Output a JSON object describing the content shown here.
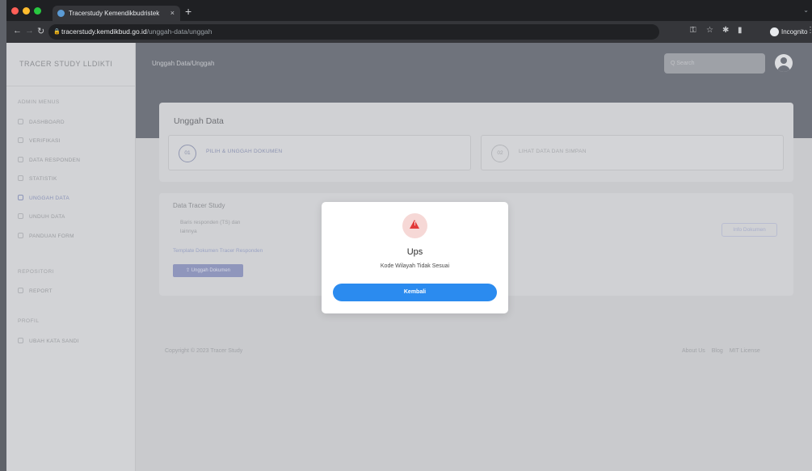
{
  "browser": {
    "tab_title": "Tracerstudy Kemendikbudristek",
    "tab_close": "×",
    "new_tab": "+",
    "url_host": "tracerstudy.kemdikbud.go.id",
    "url_path": "/unggah-data/unggah",
    "incognito_label": "Incognito",
    "traffic_colors": [
      "#ff5f57",
      "#febc2e",
      "#28c840"
    ]
  },
  "sidebar": {
    "brand": "TRACER STUDY LLDIKTI",
    "sections": [
      {
        "heading": "ADMIN MENUS",
        "items": [
          {
            "label": "DASHBOARD",
            "icon": "dashboard-icon"
          },
          {
            "label": "VERIFIKASI",
            "icon": "verify-icon"
          },
          {
            "label": "DATA RESPONDEN",
            "icon": "responden-icon"
          },
          {
            "label": "STATISTIK",
            "icon": "chart-icon"
          },
          {
            "label": "UNGGAH DATA",
            "icon": "upload-icon",
            "active": true
          },
          {
            "label": "UNDUH DATA",
            "icon": "download-icon"
          },
          {
            "label": "PANDUAN FORM",
            "icon": "guide-icon"
          }
        ]
      },
      {
        "heading": "REPOSITORI",
        "items": [
          {
            "label": "REPORT",
            "icon": "report-icon"
          }
        ]
      },
      {
        "heading": "PROFIL",
        "items": [
          {
            "label": "UBAH KATA SANDI",
            "icon": "key-icon"
          }
        ]
      }
    ]
  },
  "header": {
    "breadcrumb": "Unggah Data/Unggah",
    "search_placeholder": "Q Search"
  },
  "upload_card": {
    "title": "Unggah Data",
    "steps": [
      {
        "num": "01",
        "label": "PILIH & UNGGAH DOKUMEN",
        "active": true
      },
      {
        "num": "02",
        "label": "LIHAT DATA DAN SIMPAN",
        "active": false
      }
    ]
  },
  "tracer_card": {
    "title": "Data Tracer Study",
    "line1": "Baris responden (TS) dan",
    "line2": "lainnya",
    "template_link": "Template Dokumen Tracer Responden",
    "upload_button": "Unggah Dokumen",
    "info_button": "Info Dokumen"
  },
  "footer": {
    "copyright": "Copyright © 2023 Tracer Study",
    "links": [
      "About Us",
      "Blog",
      "MIT License"
    ]
  },
  "modal": {
    "icon": "warning-icon",
    "title": "Ups",
    "message": "Kode Wilayah Tidak Sesuai",
    "button": "Kembali"
  }
}
